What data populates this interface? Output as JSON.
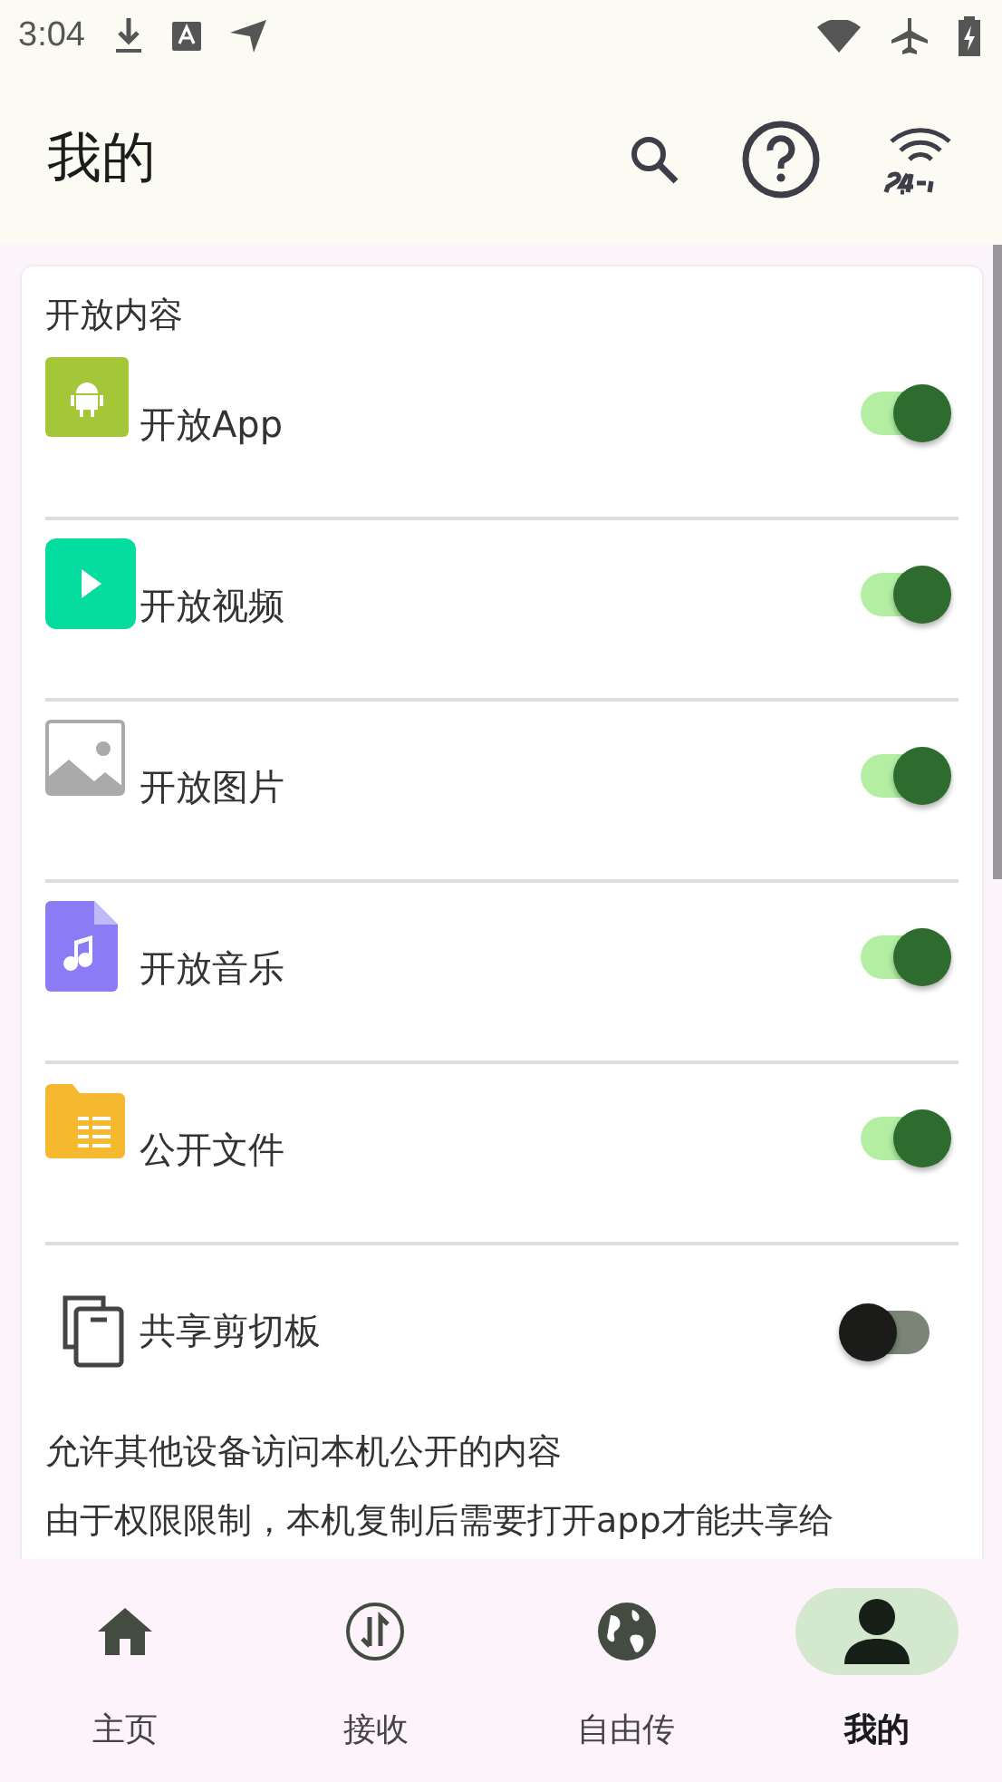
{
  "status_bar": {
    "time": "3:04"
  },
  "app_bar": {
    "title": "我的"
  },
  "card": {
    "title": "开放内容",
    "items": [
      {
        "kind": "app",
        "label": "开放App",
        "on": true
      },
      {
        "kind": "video",
        "label": "开放视频",
        "on": true
      },
      {
        "kind": "image",
        "label": "开放图片",
        "on": true
      },
      {
        "kind": "music",
        "label": "开放音乐",
        "on": true
      },
      {
        "kind": "files",
        "label": "公开文件",
        "on": true
      },
      {
        "kind": "clipboard",
        "label": "共享剪切板",
        "on": false
      }
    ],
    "notes": [
      "允许其他设备访问本机公开的内容",
      "由于权限限制，本机复制后需要打开app才能共享给"
    ]
  },
  "bottom_nav": [
    {
      "kind": "home",
      "label": "主页",
      "selected": false
    },
    {
      "kind": "receive",
      "label": "接收",
      "selected": false
    },
    {
      "kind": "globe",
      "label": "自由传",
      "selected": false
    },
    {
      "kind": "person",
      "label": "我的",
      "selected": true
    }
  ]
}
